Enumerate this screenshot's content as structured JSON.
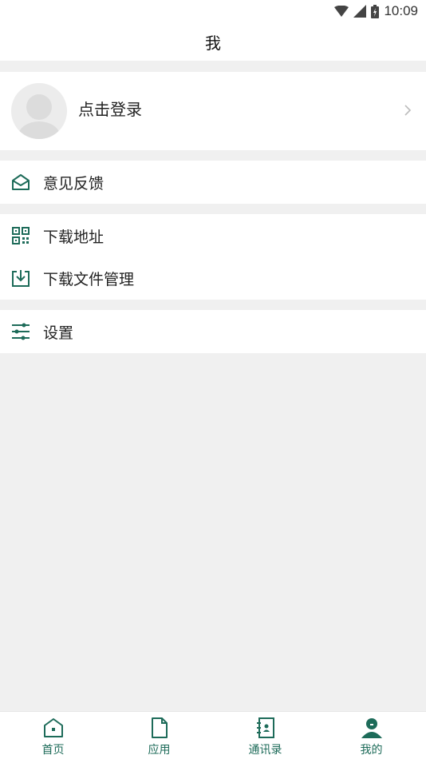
{
  "status_bar": {
    "time": "10:09"
  },
  "header": {
    "title": "我"
  },
  "profile": {
    "login_label": "点击登录"
  },
  "menu": {
    "feedback": "意见反馈",
    "download_address": "下载地址",
    "download_manager": "下载文件管理",
    "settings": "设置"
  },
  "bottom_nav": {
    "items": [
      {
        "label": "首页",
        "icon": "home-icon"
      },
      {
        "label": "应用",
        "icon": "document-icon"
      },
      {
        "label": "通讯录",
        "icon": "contacts-icon"
      },
      {
        "label": "我的",
        "icon": "person-icon",
        "active": true
      }
    ]
  },
  "colors": {
    "accent": "#1d6b59",
    "background": "#f0f0f0"
  }
}
